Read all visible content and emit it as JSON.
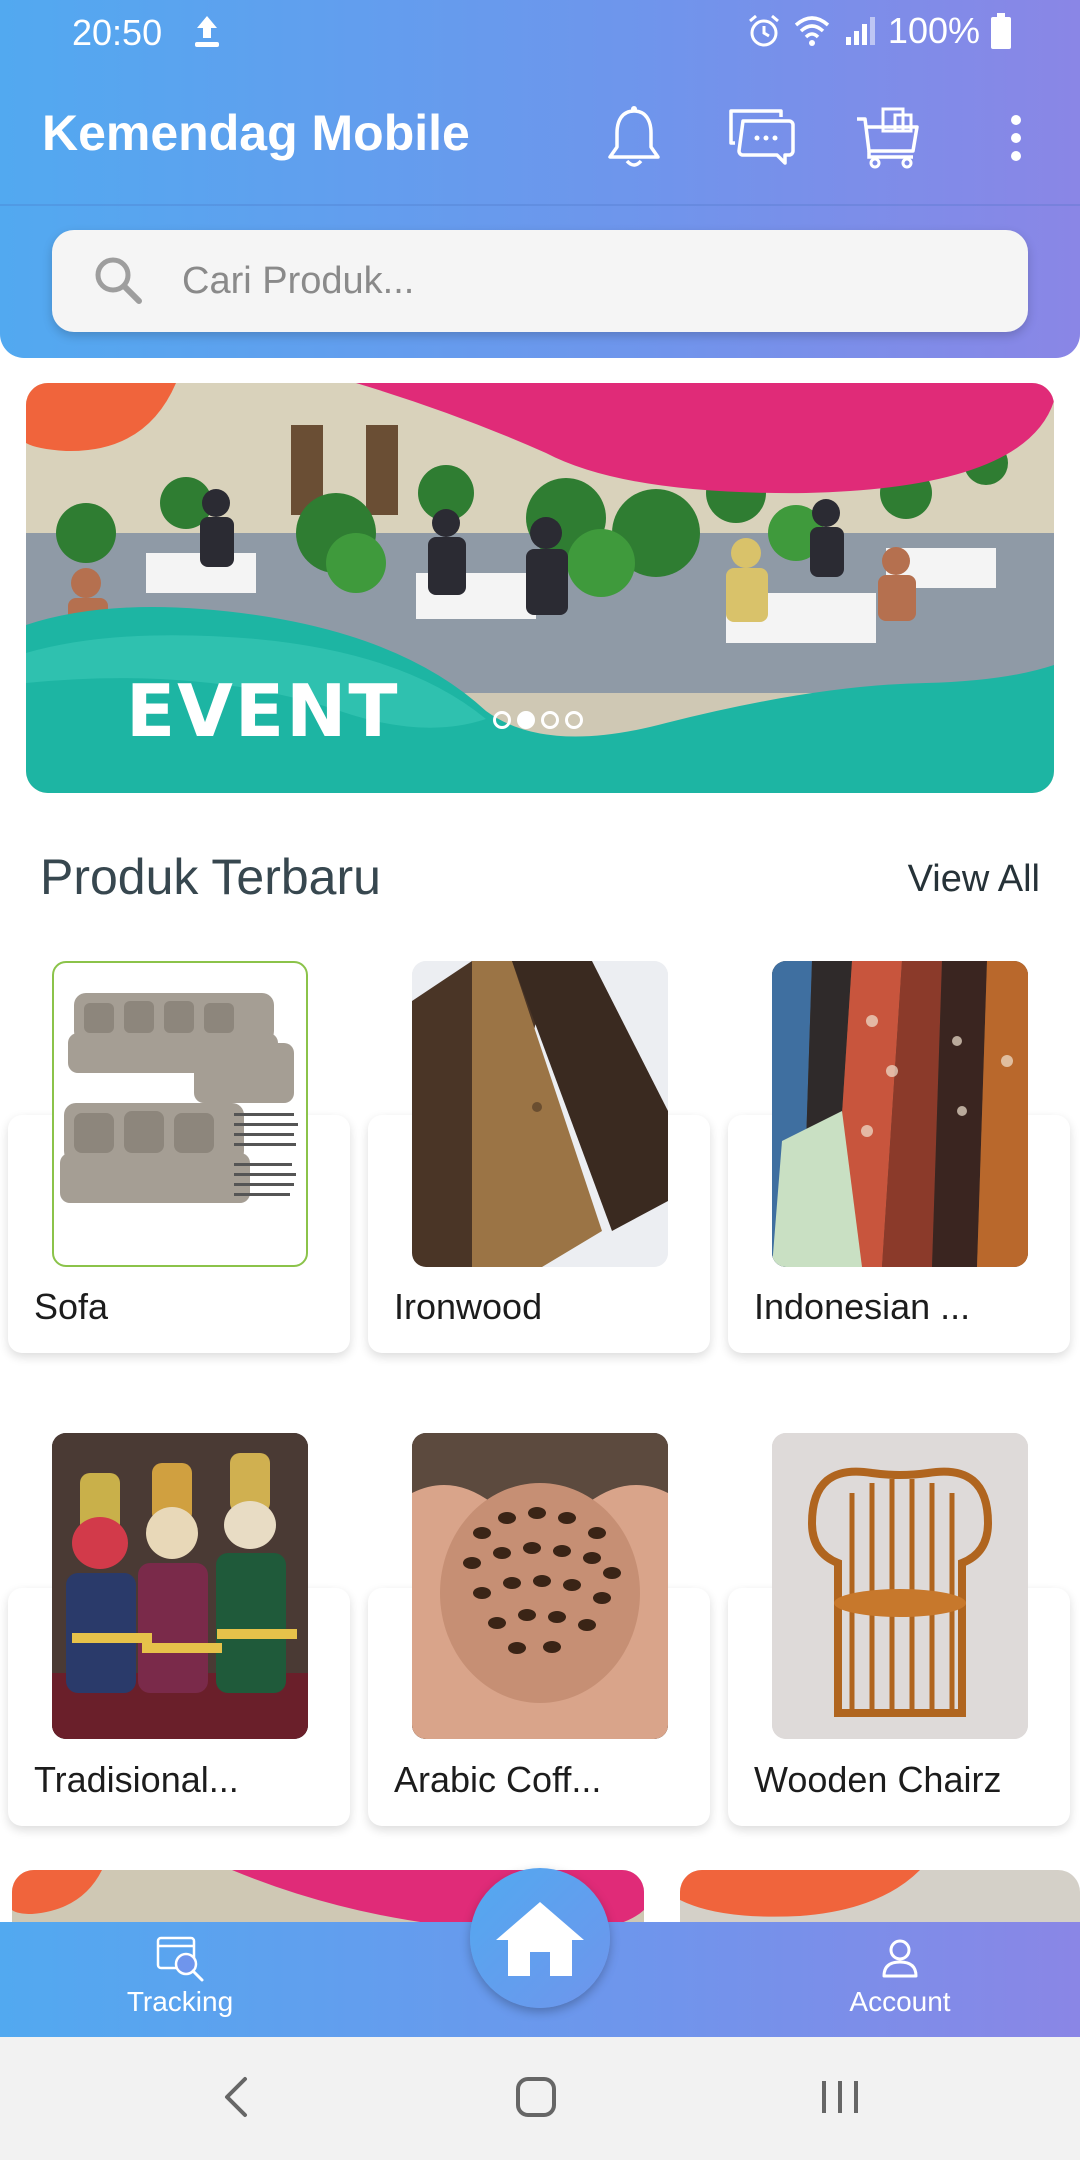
{
  "status_bar": {
    "time": "20:50",
    "battery": "100%"
  },
  "app_bar": {
    "title": "Kemendag Mobile",
    "actions": [
      "bell-icon",
      "chat-icon",
      "cart-icon",
      "more-vert-icon"
    ]
  },
  "search": {
    "placeholder": "Cari Produk..."
  },
  "banner": {
    "title": "EVENT",
    "slide_count": 4,
    "active_slide": 2
  },
  "products_section": {
    "title": "Produk Terbaru",
    "view_all": "View All",
    "items": [
      {
        "name": "Sofa"
      },
      {
        "name": "Ironwood"
      },
      {
        "name": "Indonesian ..."
      },
      {
        "name": "Tradisional..."
      },
      {
        "name": "Arabic Coff..."
      },
      {
        "name": "Wooden Chairz"
      }
    ]
  },
  "bottom_nav": {
    "left_label": "Tracking",
    "right_label": "Account"
  },
  "colors": {
    "header_gradient_start": "#52a9f0",
    "header_gradient_end": "#8a86e6",
    "banner_teal": "#1db5a3",
    "banner_pink": "#e02b78",
    "banner_orange": "#f0643c"
  }
}
